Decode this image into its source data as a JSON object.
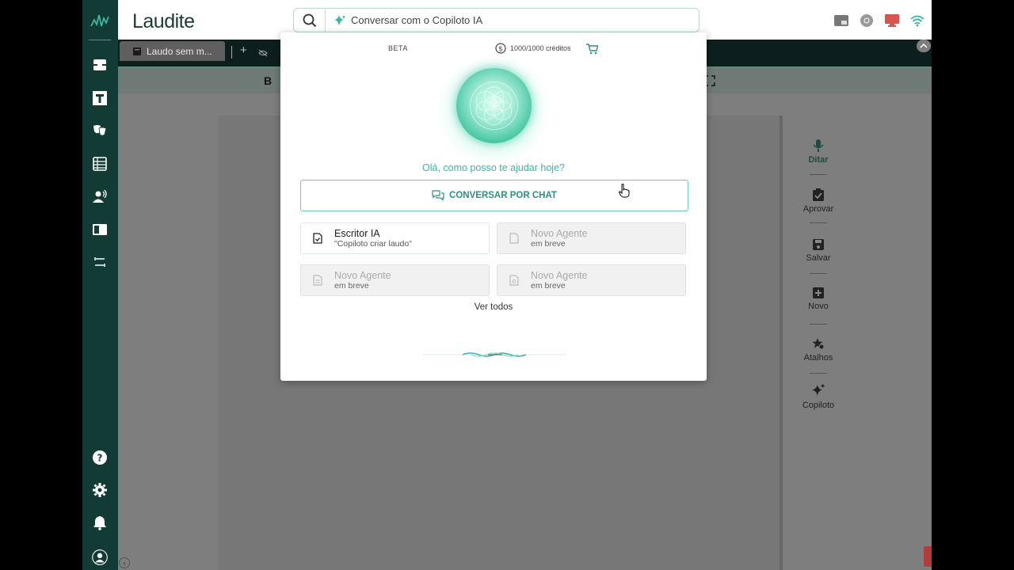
{
  "app": {
    "brand": "Laudite"
  },
  "search": {
    "placeholder": "Conversar com o Copiloto IA"
  },
  "tabs": {
    "active_label": "Laudo sem m..."
  },
  "format": {
    "bold": "B"
  },
  "right_panel": {
    "items": [
      {
        "label": "Ditar",
        "icon": "microphone-icon"
      },
      {
        "label": "Aprovar",
        "icon": "clipboard-check-icon"
      },
      {
        "label": "Salvar",
        "icon": "save-icon"
      },
      {
        "label": "Novo",
        "icon": "new-document-icon"
      },
      {
        "label": "Atalhos",
        "icon": "star-gear-icon"
      },
      {
        "label": "Copiloto",
        "icon": "sparkle-icon"
      }
    ]
  },
  "sidebar": {
    "icons": [
      "inbox-icon",
      "text-icon",
      "theater-masks-icon",
      "spreadsheet-icon",
      "voice-user-icon",
      "book-icon",
      "workflow-icon",
      "help-icon",
      "settings-icon",
      "bell-icon",
      "user-avatar-icon"
    ]
  },
  "copilot": {
    "beta": "BETA",
    "credits": "1000/1000 créditos",
    "greeting": "Olá, como posso te ajudar hoje?",
    "chat_button": "CONVERSAR POR CHAT",
    "cards": [
      {
        "title": "Escritor IA",
        "subtitle": "\"Copiloto criar laudo\"",
        "enabled": true
      },
      {
        "title": "Novo Agente",
        "subtitle": "em breve",
        "enabled": false
      },
      {
        "title": "Novo Agente",
        "subtitle": "em breve",
        "enabled": false
      },
      {
        "title": "Novo Agente",
        "subtitle": "em breve",
        "enabled": false
      }
    ],
    "see_all": "Ver todos"
  },
  "colors": {
    "sidebar": "#133b35",
    "accent": "#3bb7a7",
    "brand_text": "#1b3a36"
  }
}
